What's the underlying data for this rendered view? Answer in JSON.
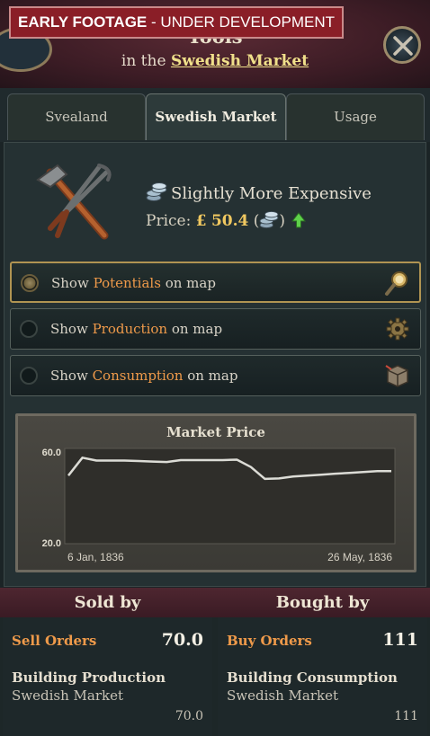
{
  "banner": {
    "strong": "EARLY FOOTAGE",
    "rest": " - UNDER DEVELOPMENT"
  },
  "header": {
    "title": "Tools",
    "sub_prefix": "in the ",
    "sub_link": "Swedish Market"
  },
  "tabs": [
    {
      "label": "Svealand",
      "active": false
    },
    {
      "label": "Swedish Market",
      "active": true
    },
    {
      "label": "Usage",
      "active": false
    }
  ],
  "goods": {
    "icon": "tools-icon",
    "price_status": "Slightly More Expensive",
    "price_label": "Price:",
    "price_currency": "£",
    "price_value": "50.4",
    "price_paren_open": "(",
    "price_paren_close": ")",
    "trend": "up"
  },
  "toggles": [
    {
      "prefix": "Show ",
      "highlight": "Potentials",
      "suffix": " on map",
      "active": true,
      "icon": "magnifier-icon"
    },
    {
      "prefix": "Show ",
      "highlight": "Production",
      "suffix": " on map",
      "active": false,
      "icon": "gear-icon"
    },
    {
      "prefix": "Show ",
      "highlight": "Consumption",
      "suffix": " on map",
      "active": false,
      "icon": "crate-icon"
    }
  ],
  "chart_data": {
    "type": "line",
    "title": "Market Price",
    "y_ticks": [
      "60.0",
      "20.0"
    ],
    "ylim": [
      20,
      60
    ],
    "x_ticks": [
      "6 Jan, 1836",
      "26 May, 1836"
    ],
    "series": [
      {
        "values": [
          48.6,
          56.1,
          54.9,
          54.9,
          54.9,
          54.7,
          54.5,
          54.3,
          55.1,
          55.1,
          55.1,
          55.1,
          55.3,
          52.2,
          47.2,
          47.4,
          48.2,
          48.6,
          49.0,
          49.4,
          49.7,
          50.1,
          50.5,
          50.5
        ]
      }
    ],
    "color": "#dcdcd6",
    "grid": false
  },
  "sold_by": {
    "title": "Sold by",
    "orders_label": "Sell Orders",
    "orders_value": "70.0",
    "building_title": "Building Production",
    "building_sub": "Swedish Market",
    "building_value": "70.0"
  },
  "bought_by": {
    "title": "Bought by",
    "orders_label": "Buy Orders",
    "orders_value": "111",
    "building_title": "Building Consumption",
    "building_sub": "Swedish Market",
    "building_value": "111"
  }
}
